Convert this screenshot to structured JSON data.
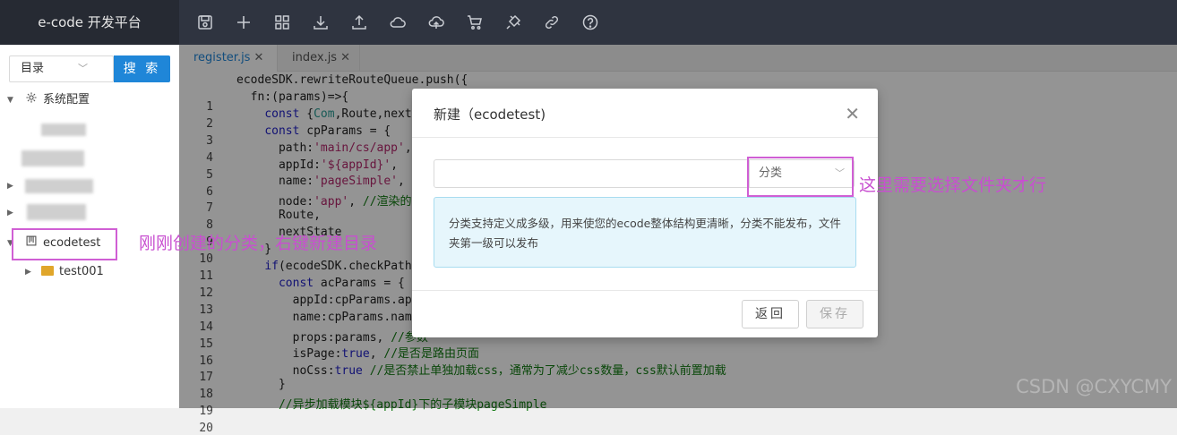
{
  "app": {
    "title": "e-code 开发平台"
  },
  "toolbar": {
    "icons": [
      "save-icon",
      "add-icon",
      "grid-icon",
      "download-icon",
      "upload-icon",
      "cloud-icon",
      "cloud-upload-icon",
      "cart-icon",
      "plugin-icon",
      "link-icon",
      "help-icon"
    ]
  },
  "sidebar": {
    "select_value": "目录",
    "search_label": "搜 索",
    "tree": {
      "system_config": "系统配置",
      "ecodetest": "ecodetest",
      "test001": "test001"
    }
  },
  "editor": {
    "tabs": [
      {
        "label": "register.js"
      },
      {
        "label": "index.js"
      }
    ],
    "line_numbers": [
      "1",
      "2",
      "3",
      "4",
      "5",
      "6",
      "7",
      "8",
      "9",
      "10",
      "11",
      "12",
      "13",
      "14",
      "15",
      "16",
      "17",
      "18",
      "19",
      "20"
    ],
    "lines": [
      "ecodeSDK.rewriteRouteQueue.push({",
      "  fn:(params)=>{",
      "    const {Com,Route,nextS",
      "    const cpParams = {",
      "      path:'main/cs/app',",
      "      appId:'${appId}',",
      "      name:'pageSimple', /",
      "      node:'app', //渲染的",
      "      Route,",
      "      nextState",
      "    }",
      "    if(ecodeSDK.checkPath(",
      "      const acParams = {",
      "        appId:cpParams.app",
      "        name:cpParams.name",
      "        props:params, //参数",
      "        isPage:true, //是否是路由页面",
      "        noCss:true //是否禁止单独加载css，通常为了减少css数量，css默认前置加载",
      "      }",
      "      //异步加载模块${appId}下的子模块pageSimple"
    ]
  },
  "modal": {
    "title": "新建（ecodetest)",
    "name_value": "",
    "category_placeholder": "分类",
    "info_text": "分类支持定义成多级，用来使您的ecode整体结构更清晰，分类不能发布，文件夹第一级可以发布",
    "back_label": "返回",
    "save_label": "保存"
  },
  "annotations": {
    "left": "刚刚创建的分类，右键新建目录",
    "right": "这里需要选择文件夹才行",
    "color": "#c84fd0"
  },
  "watermark": "CSDN @CXYCMY"
}
